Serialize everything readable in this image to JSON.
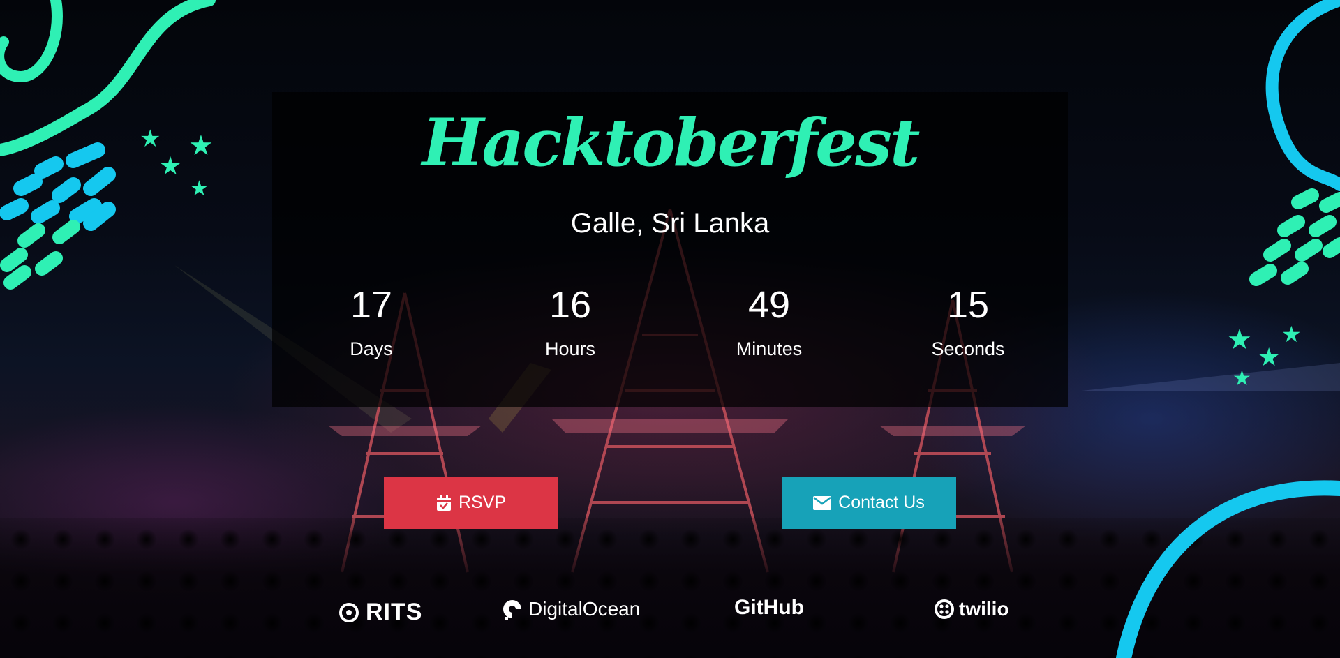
{
  "colors": {
    "accent": "#2ff0b4",
    "accent_blue": "#13c6f2",
    "rsvp": "#dc3545",
    "contact": "#17a2b8"
  },
  "event": {
    "title": "Hacktoberfest",
    "location": "Galle, Sri Lanka"
  },
  "countdown": [
    {
      "value": "17",
      "label": "Days"
    },
    {
      "value": "16",
      "label": "Hours"
    },
    {
      "value": "49",
      "label": "Minutes"
    },
    {
      "value": "15",
      "label": "Seconds"
    }
  ],
  "buttons": {
    "rsvp": {
      "label": "RSVP",
      "icon": "calendar-check-icon"
    },
    "contact": {
      "label": "Contact Us",
      "icon": "envelope-icon"
    }
  },
  "sponsors": [
    {
      "name": "RITS",
      "icon": "rits-logo"
    },
    {
      "name": "DigitalOcean",
      "icon": "digitalocean-logo"
    },
    {
      "name": "GitHub",
      "icon": "github-logo"
    },
    {
      "name": "twilio",
      "icon": "twilio-logo"
    }
  ]
}
